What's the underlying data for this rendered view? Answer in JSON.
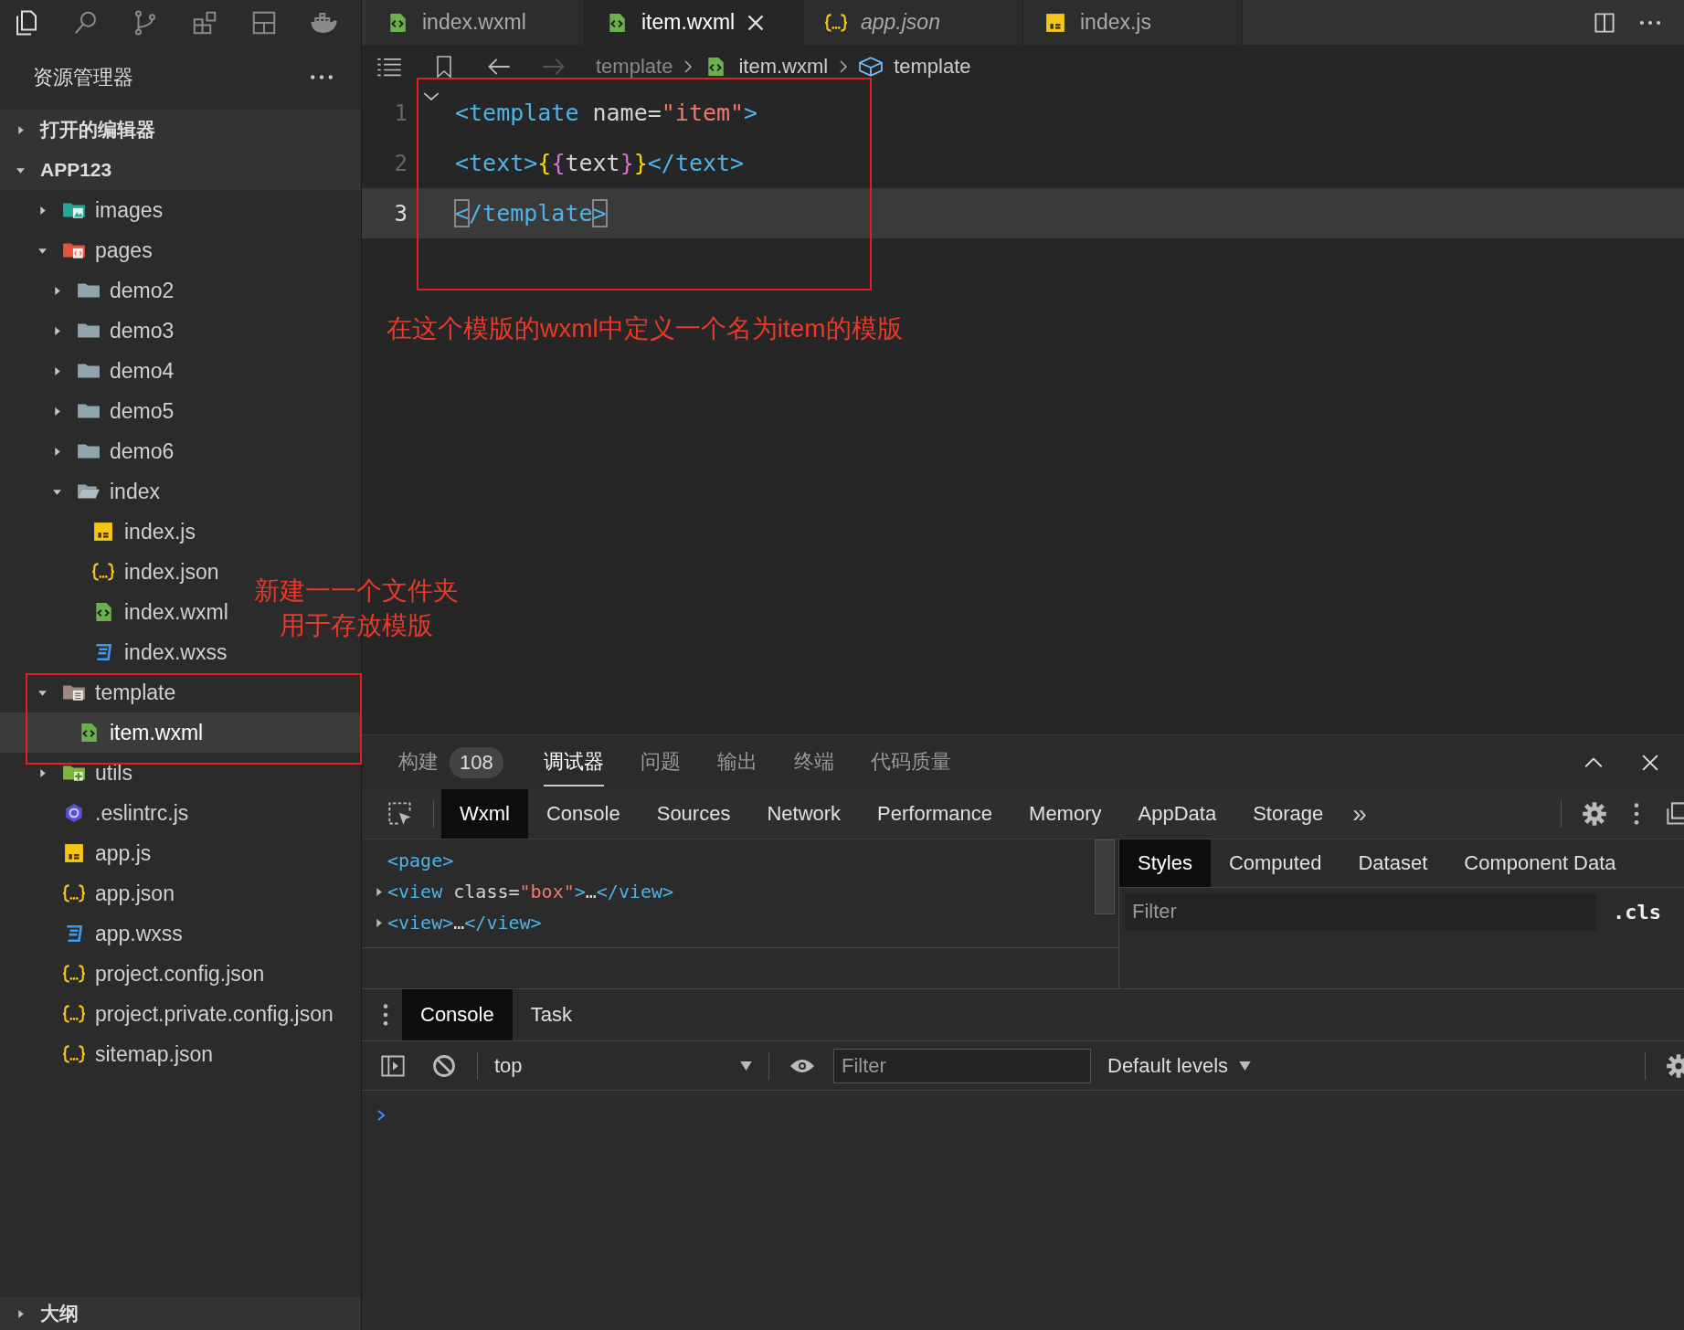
{
  "editor_tabs": [
    {
      "label": "index.wxml",
      "kind": "wxml",
      "selected": false,
      "preview": false
    },
    {
      "label": "item.wxml",
      "kind": "wxml",
      "selected": true,
      "preview": false
    },
    {
      "label": "app.json",
      "kind": "json",
      "selected": false,
      "preview": true
    },
    {
      "label": "index.js",
      "kind": "js",
      "selected": false,
      "preview": false
    }
  ],
  "sidebar": {
    "title": "资源管理器",
    "sections": [
      {
        "label": "打开的编辑器",
        "expanded": false
      },
      {
        "label": "APP123",
        "expanded": true
      }
    ],
    "tree": [
      {
        "name": "images",
        "kind": "images",
        "expanded": false,
        "selected": false
      },
      {
        "name": "pages",
        "kind": "pages",
        "expanded": true,
        "selected": false,
        "children": [
          {
            "name": "demo2",
            "kind": "folder",
            "expanded": false,
            "selected": false
          },
          {
            "name": "demo3",
            "kind": "folder",
            "expanded": false,
            "selected": false
          },
          {
            "name": "demo4",
            "kind": "folder",
            "expanded": false,
            "selected": false
          },
          {
            "name": "demo5",
            "kind": "folder",
            "expanded": false,
            "selected": false
          },
          {
            "name": "demo6",
            "kind": "folder",
            "expanded": false,
            "selected": false
          },
          {
            "name": "index",
            "kind": "folder",
            "expanded": true,
            "selected": false,
            "children": [
              {
                "name": "index.js",
                "kind": "js",
                "selected": false
              },
              {
                "name": "index.json",
                "kind": "json",
                "selected": false
              },
              {
                "name": "index.wxml",
                "kind": "wxml",
                "selected": false
              },
              {
                "name": "index.wxss",
                "kind": "wxss",
                "selected": false
              }
            ]
          }
        ]
      },
      {
        "name": "template",
        "kind": "template",
        "expanded": true,
        "selected": false,
        "children": [
          {
            "name": "item.wxml",
            "kind": "wxml",
            "selected": true
          }
        ]
      },
      {
        "name": "utils",
        "kind": "utils",
        "expanded": false,
        "selected": false
      },
      {
        "name": ".eslintrc.js",
        "kind": "eslint",
        "selected": false
      },
      {
        "name": "app.js",
        "kind": "js",
        "selected": false
      },
      {
        "name": "app.json",
        "kind": "json",
        "selected": false
      },
      {
        "name": "app.wxss",
        "kind": "wxss",
        "selected": false
      },
      {
        "name": "project.config.json",
        "kind": "json",
        "selected": false
      },
      {
        "name": "project.private.config.json",
        "kind": "json",
        "selected": false
      },
      {
        "name": "sitemap.json",
        "kind": "json",
        "selected": false
      }
    ],
    "annotation": [
      "新建一一个文件夹",
      "用于存放模版"
    ],
    "outline": {
      "label": "大纲",
      "expanded": false
    }
  },
  "breadcrumb": [
    {
      "label": "template",
      "kind": "folder"
    },
    {
      "label": "item.wxml",
      "kind": "wxml"
    },
    {
      "label": "template",
      "kind": "symbol"
    }
  ],
  "code": [
    {
      "number": "1",
      "current": false,
      "folded": false,
      "tokens": [
        {
          "text": "<template",
          "kind": "tag"
        },
        {
          "text": " name=",
          "kind": "attr"
        },
        {
          "text": "\"item\"",
          "kind": "string"
        },
        {
          "text": ">",
          "kind": "tag"
        }
      ]
    },
    {
      "number": "2",
      "current": false,
      "tokens": [
        {
          "text": "<text>",
          "kind": "tag"
        },
        {
          "text": "{",
          "kind": "brace-outer"
        },
        {
          "text": "{",
          "kind": "brace-inner"
        },
        {
          "text": "text",
          "kind": "plain"
        },
        {
          "text": "}",
          "kind": "brace-inner"
        },
        {
          "text": "}",
          "kind": "brace-outer"
        },
        {
          "text": "</text>",
          "kind": "tag"
        }
      ]
    },
    {
      "number": "3",
      "current": true,
      "tokens": [
        {
          "text": "<",
          "kind": "match"
        },
        {
          "text": "/template",
          "kind": "tag"
        },
        {
          "text": ">",
          "kind": "match"
        }
      ]
    }
  ],
  "editor_annotation": "在这个模版的wxml中定义一个名为item的模版",
  "panel": {
    "tabs": [
      {
        "label": "构建",
        "badge": "108",
        "selected": false
      },
      {
        "label": "调试器",
        "selected": true
      },
      {
        "label": "问题",
        "selected": false
      },
      {
        "label": "输出",
        "selected": false
      },
      {
        "label": "终端",
        "selected": false
      },
      {
        "label": "代码质量",
        "selected": false
      }
    ],
    "devtools": {
      "tabs": [
        {
          "label": "Wxml",
          "selected": true
        },
        {
          "label": "Console",
          "selected": false
        },
        {
          "label": "Sources",
          "selected": false
        },
        {
          "label": "Network",
          "selected": false
        },
        {
          "label": "Performance",
          "selected": false
        },
        {
          "label": "Memory",
          "selected": false
        },
        {
          "label": "AppData",
          "selected": false
        },
        {
          "label": "Storage",
          "selected": false
        }
      ],
      "more": "»",
      "wxml_tree": [
        {
          "tokens": [
            {
              "text": "<page>",
              "kind": "tag"
            }
          ]
        },
        {
          "expanded": false,
          "tokens": [
            {
              "text": "<view",
              "kind": "tag"
            },
            {
              "text": " class=",
              "kind": "attr"
            },
            {
              "text": "\"box\"",
              "kind": "string"
            },
            {
              "text": ">",
              "kind": "tag"
            },
            {
              "text": "…",
              "kind": "plain"
            },
            {
              "text": "</view>",
              "kind": "tag"
            }
          ]
        },
        {
          "expanded": false,
          "tokens": [
            {
              "text": "<view>",
              "kind": "tag"
            },
            {
              "text": "…",
              "kind": "plain"
            },
            {
              "text": "</view>",
              "kind": "tag"
            }
          ]
        }
      ],
      "styles_tabs": [
        {
          "label": "Styles",
          "selected": true
        },
        {
          "label": "Computed",
          "selected": false
        },
        {
          "label": "Dataset",
          "selected": false
        },
        {
          "label": "Component Data",
          "selected": false
        }
      ],
      "filter_placeholder": "Filter",
      "cls": ".cls"
    },
    "console": {
      "tabs": [
        {
          "label": "Console",
          "selected": true
        },
        {
          "label": "Task",
          "selected": false
        }
      ],
      "context": "top",
      "filter_placeholder": "Filter",
      "levels": "Default levels"
    }
  }
}
